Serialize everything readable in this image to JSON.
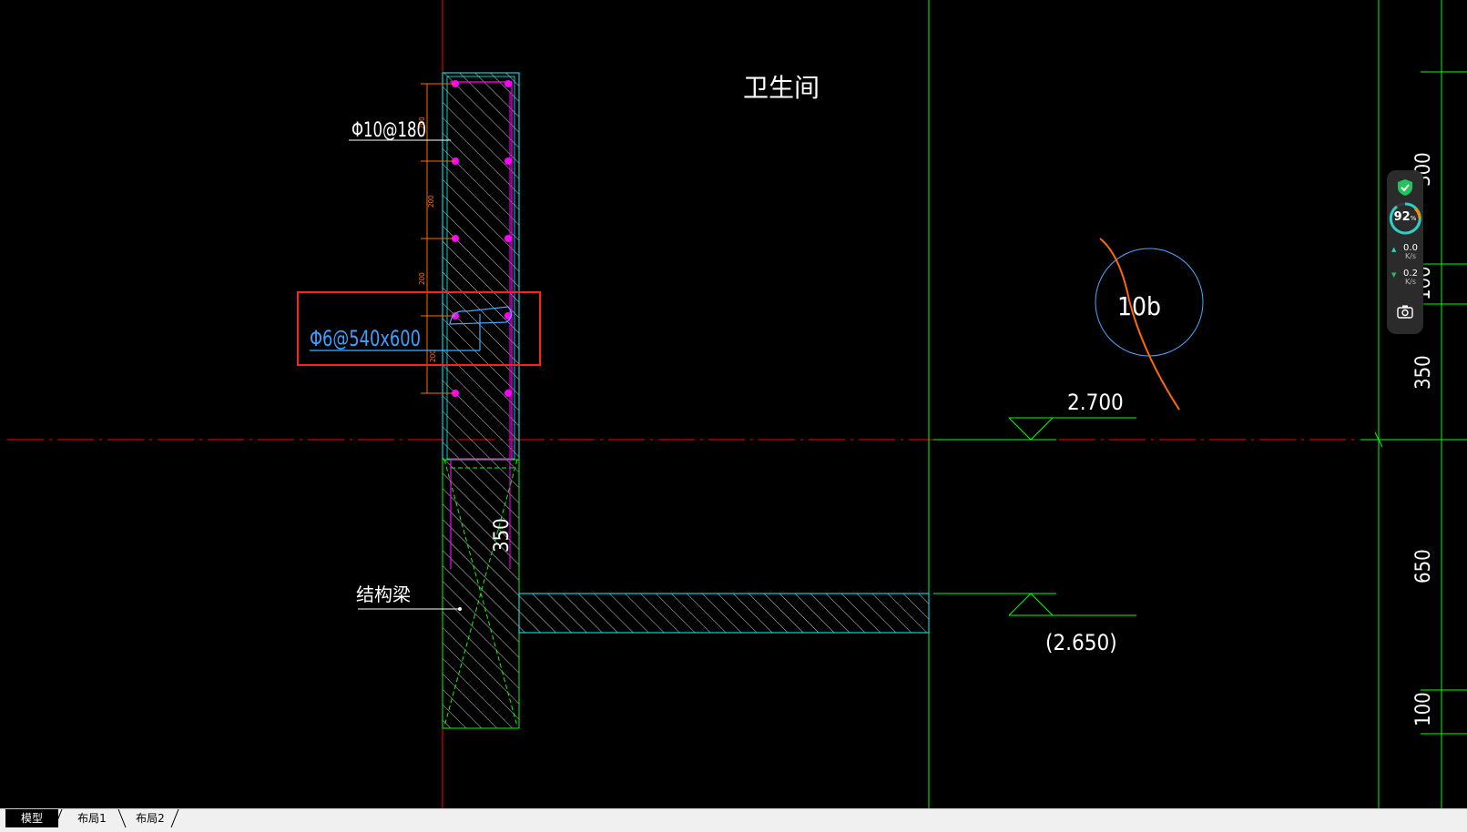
{
  "drawing": {
    "room_label": "卫生间",
    "rebar_vertical_label": "Φ10@180",
    "rebar_tie_label": "Φ6@540x600",
    "beam_label": "结构梁",
    "beam_height_dim": "350",
    "elevation_top": "2.700",
    "elevation_bottom": "(2.650)",
    "bubble_label": "10b",
    "small_dims": [
      "200",
      "200",
      "200",
      "200"
    ],
    "right_dims": [
      "300",
      "100",
      "350",
      "650",
      "100"
    ]
  },
  "widget": {
    "gauge_value": "92",
    "gauge_unit": "%",
    "upload_value": "0.0",
    "upload_unit": "K/s",
    "download_value": "0.2",
    "download_unit": "K/s"
  },
  "tabs": {
    "model": "模型",
    "layout1": "布局1",
    "layout2": "布局2"
  },
  "colors": {
    "background": "#000000",
    "axis_red": "#ff0000",
    "grid_green": "#00ff00",
    "section_cyan": "#00ffff",
    "rebar_magenta": "#ff00ff",
    "highlight_red": "#ff2020",
    "dimension_orange": "#ff6a00",
    "annotation_white": "#ffffff"
  }
}
